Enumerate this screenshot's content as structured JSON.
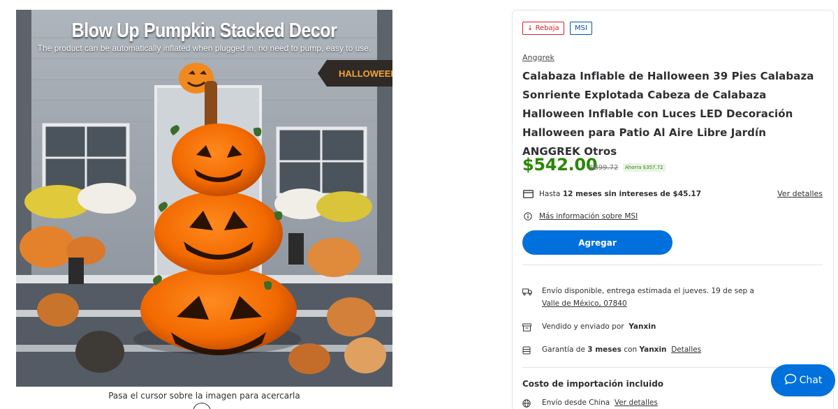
{
  "image": {
    "title": "Blow Up Pumpkin Stacked Decor",
    "subtitle": "The product can be automatically inflated when plugged in, no need to pump, easy to use.",
    "sign_text": "HALLOWEEN",
    "hover_hint": "Pasa el cursor sobre la imagen para acercarla"
  },
  "badges": {
    "rebaja": "Rebaja",
    "msi": "MSI"
  },
  "product": {
    "brand": "Anggrek",
    "title": "Calabaza Inflable de Halloween 39 Pies Calabaza Sonriente Explotada Cabeza de Calabaza Halloween Inflable con Luces LED Decoración Halloween para Patio Al Aire Libre Jardín ANGGREK Otros",
    "price": "$542.00",
    "was_price": "$899.72",
    "savings": "Ahorra $357.72"
  },
  "installments": {
    "prefix": "Hasta",
    "bold": "12 meses sin intereses de $45.17",
    "details_link": "Ver detalles",
    "msi_info_link": "Más información sobre MSI"
  },
  "add_button": "Agregar",
  "shipping": {
    "text": "Envío disponible, entrega estimada el jueves. 19 de sep a",
    "location": "Valle de México, 07840"
  },
  "seller": {
    "prefix": "Vendido y enviado por",
    "name": "Yanxin"
  },
  "warranty": {
    "prefix": "Garantía de",
    "months": "3 meses",
    "con": "con",
    "seller": "Yanxin",
    "link": "Detalles"
  },
  "import": {
    "heading": "Costo de importación incluido",
    "origin": "Envío desde China",
    "link": "Ver detalles"
  },
  "chat": {
    "label": "Chat"
  },
  "colors": {
    "accent": "#0071dc",
    "price_green": "#2a8703",
    "sale_red": "#de1c24"
  }
}
